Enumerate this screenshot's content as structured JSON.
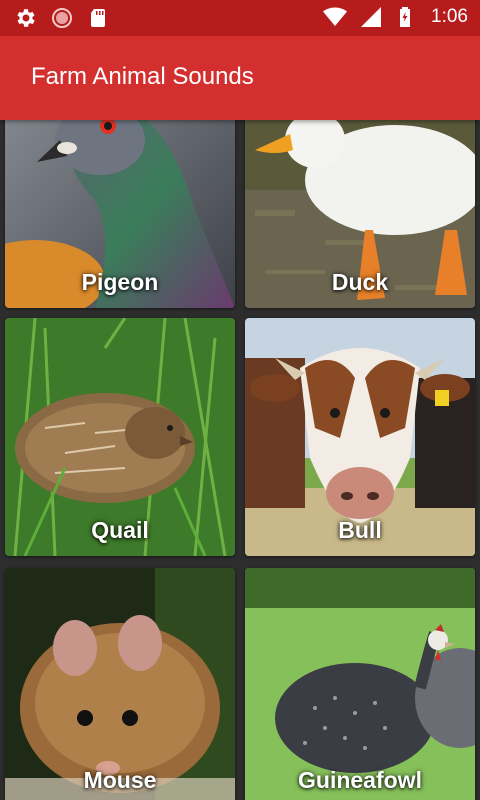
{
  "status_bar": {
    "time": "1:06",
    "icons": [
      "settings-icon",
      "record-icon",
      "sd-card-icon",
      "wifi-icon",
      "signal-icon",
      "battery-charging-icon"
    ]
  },
  "app_bar": {
    "title": "Farm Animal Sounds"
  },
  "animals": [
    {
      "name": "Pigeon"
    },
    {
      "name": "Duck"
    },
    {
      "name": "Quail"
    },
    {
      "name": "Bull"
    },
    {
      "name": "Mouse"
    },
    {
      "name": "Guineafowl"
    }
  ],
  "colors": {
    "status_bar": "#b71c1c",
    "app_bar": "#d32f2f",
    "background": "#2d2d2d"
  }
}
